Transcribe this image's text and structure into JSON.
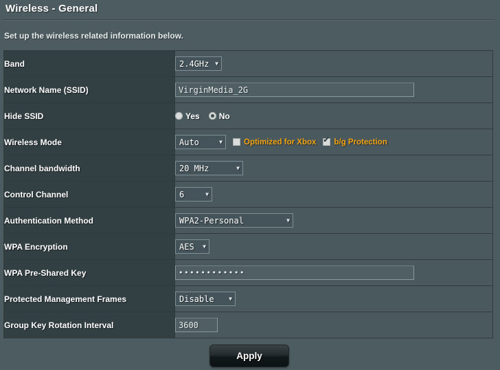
{
  "header": {
    "title": "Wireless - General",
    "subtitle": "Set up the wireless related information below."
  },
  "rows": {
    "band": {
      "label": "Band",
      "value": "2.4GHz",
      "caret": "▼"
    },
    "ssid": {
      "label": "Network Name (SSID)",
      "value": "VirginMedia_2G"
    },
    "hide_ssid": {
      "label": "Hide SSID",
      "options": [
        {
          "label": "Yes",
          "selected": false
        },
        {
          "label": "No",
          "selected": true
        }
      ]
    },
    "wireless_mode": {
      "label": "Wireless Mode",
      "value": "Auto",
      "caret": "▼",
      "checkboxes": [
        {
          "label": "Optimized for Xbox",
          "checked": false
        },
        {
          "label": "b/g Protection",
          "checked": true
        }
      ]
    },
    "channel_bandwidth": {
      "label": "Channel bandwidth",
      "value": "20 MHz",
      "caret": "▼"
    },
    "control_channel": {
      "label": "Control Channel",
      "value": "6",
      "caret": "▼"
    },
    "auth_method": {
      "label": "Authentication Method",
      "value": "WPA2-Personal",
      "caret": "▼"
    },
    "wpa_encryption": {
      "label": "WPA Encryption",
      "value": "AES",
      "caret": "▼"
    },
    "wpa_psk": {
      "label": "WPA Pre-Shared Key",
      "value": "••••••••••••"
    },
    "pmf": {
      "label": "Protected Management Frames",
      "value": "Disable",
      "caret": "▼"
    },
    "group_key_rotation": {
      "label": "Group Key Rotation Interval",
      "value": "3600"
    }
  },
  "footer": {
    "apply_label": "Apply"
  },
  "colors": {
    "page_background": "#4d5c60",
    "label_cell": "#323f43",
    "value_cell": "#4a595d",
    "accent_orange": "#f1a314",
    "border": "#2f3a3d"
  }
}
